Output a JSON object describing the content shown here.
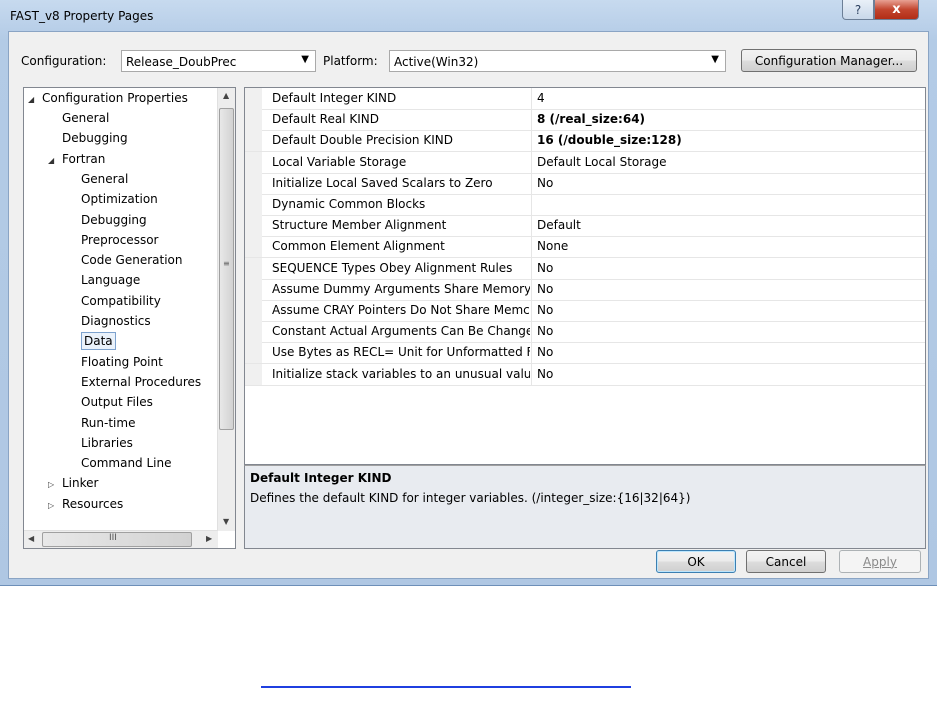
{
  "window": {
    "title": "FAST_v8 Property Pages",
    "help_label": "?",
    "close_label": "x"
  },
  "toolbar": {
    "configuration_label": "Configuration:",
    "configuration_value": "Release_DoubPrec",
    "platform_label": "Platform:",
    "platform_value": "Active(Win32)",
    "config_manager_label": "Configuration Manager..."
  },
  "tree": {
    "root": "Configuration Properties",
    "items": [
      {
        "label": "General",
        "level": 1
      },
      {
        "label": "Debugging",
        "level": 1
      },
      {
        "label": "Fortran",
        "level": 1,
        "expanded": true
      },
      {
        "label": "General",
        "level": 2
      },
      {
        "label": "Optimization",
        "level": 2
      },
      {
        "label": "Debugging",
        "level": 2
      },
      {
        "label": "Preprocessor",
        "level": 2
      },
      {
        "label": "Code Generation",
        "level": 2
      },
      {
        "label": "Language",
        "level": 2
      },
      {
        "label": "Compatibility",
        "level": 2
      },
      {
        "label": "Diagnostics",
        "level": 2
      },
      {
        "label": "Data",
        "level": 2,
        "selected": true
      },
      {
        "label": "Floating Point",
        "level": 2
      },
      {
        "label": "External Procedures",
        "level": 2
      },
      {
        "label": "Output Files",
        "level": 2
      },
      {
        "label": "Run-time",
        "level": 2
      },
      {
        "label": "Libraries",
        "level": 2
      },
      {
        "label": "Command Line",
        "level": 2
      },
      {
        "label": "Linker",
        "level": 1,
        "collapsed": true
      },
      {
        "label": "Resources",
        "level": 1,
        "collapsed": true
      }
    ],
    "hscroll_grip": "III"
  },
  "properties": [
    {
      "name": "Default Integer KIND",
      "value": "4",
      "bold": false
    },
    {
      "name": "Default Real KIND",
      "value": "8 (/real_size:64)",
      "bold": true
    },
    {
      "name": "Default Double Precision KIND",
      "value": "16 (/double_size:128)",
      "bold": true
    },
    {
      "name": "Local Variable Storage",
      "value": "Default Local Storage",
      "bold": false
    },
    {
      "name": "Initialize Local Saved Scalars to Zero",
      "value": "No",
      "bold": false
    },
    {
      "name": "Dynamic Common Blocks",
      "value": "",
      "bold": false
    },
    {
      "name": "Structure Member Alignment",
      "value": "Default",
      "bold": false
    },
    {
      "name": "Common Element Alignment",
      "value": "None",
      "bold": false
    },
    {
      "name": "SEQUENCE Types Obey Alignment Rules",
      "value": "No",
      "bold": false
    },
    {
      "name": "Assume Dummy Arguments Share Memory",
      "value": "No",
      "bold": false
    },
    {
      "name": "Assume CRAY Pointers Do Not Share Memc",
      "value": "No",
      "bold": false
    },
    {
      "name": "Constant Actual Arguments Can Be Change",
      "value": "No",
      "bold": false
    },
    {
      "name": "Use Bytes as RECL= Unit for Unformatted Fil",
      "value": "No",
      "bold": false
    },
    {
      "name": "Initialize stack variables to an unusual value",
      "value": "No",
      "bold": false
    }
  ],
  "description": {
    "title": "Default Integer KIND",
    "text": "Defines the default KIND for integer variables. (/integer_size:{16|32|64})"
  },
  "buttons": {
    "ok": "OK",
    "cancel": "Cancel",
    "apply": "Apply"
  }
}
